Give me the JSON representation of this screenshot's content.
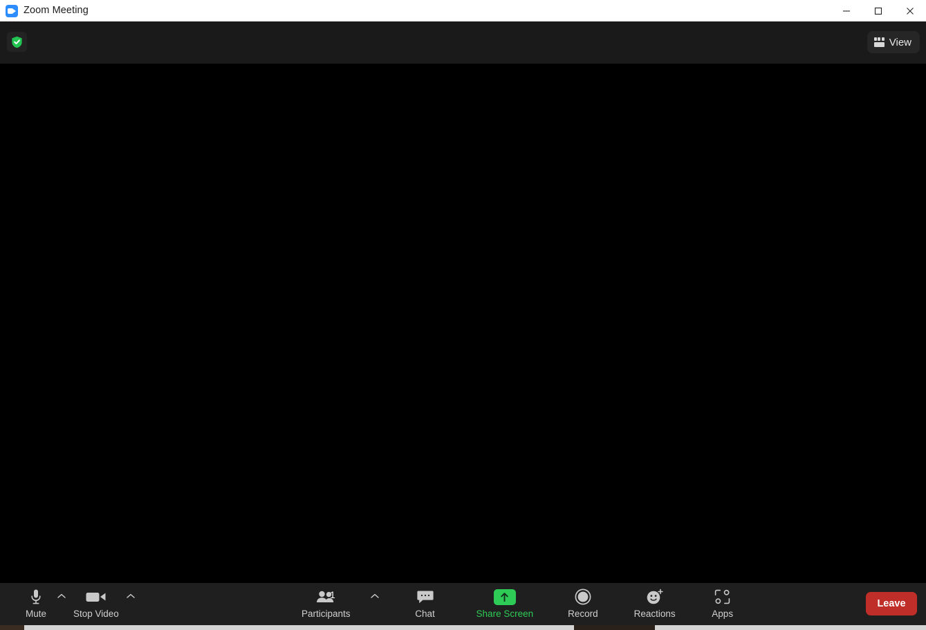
{
  "window": {
    "title": "Zoom Meeting",
    "app_icon": "zoom-video-icon",
    "controls": {
      "minimize": "minimize-icon",
      "maximize": "maximize-icon",
      "close": "close-icon"
    }
  },
  "header": {
    "security_icon": "shield-check-icon",
    "view_button": {
      "label": "View",
      "icon": "grid-layout-icon"
    }
  },
  "stage": {
    "background_color": "#000000"
  },
  "toolbar": {
    "background_color": "#1f1f1f",
    "left_controls": [
      {
        "name": "mute",
        "label": "Mute",
        "icon": "microphone-icon",
        "has_caret": true,
        "caret_icon": "chevron-up-icon"
      },
      {
        "name": "stop-video",
        "label": "Stop Video",
        "icon": "video-camera-icon",
        "has_caret": true,
        "caret_icon": "chevron-up-icon"
      }
    ],
    "center_controls": [
      {
        "name": "participants",
        "label": "Participants",
        "icon": "people-icon",
        "count": "1",
        "has_caret": true,
        "caret_icon": "chevron-up-icon"
      },
      {
        "name": "chat",
        "label": "Chat",
        "icon": "chat-bubble-icon",
        "has_caret": false
      },
      {
        "name": "share-screen",
        "label": "Share Screen",
        "icon": "share-arrow-up-icon",
        "has_caret": false,
        "accent_color": "#2ecc57"
      },
      {
        "name": "record",
        "label": "Record",
        "icon": "record-circle-icon",
        "has_caret": false
      },
      {
        "name": "reactions",
        "label": "Reactions",
        "icon": "smiley-plus-icon",
        "has_caret": false
      },
      {
        "name": "apps",
        "label": "Apps",
        "icon": "apps-bracket-icon",
        "has_caret": false
      }
    ],
    "leave_button": {
      "label": "Leave",
      "color": "#bf2e28"
    }
  }
}
